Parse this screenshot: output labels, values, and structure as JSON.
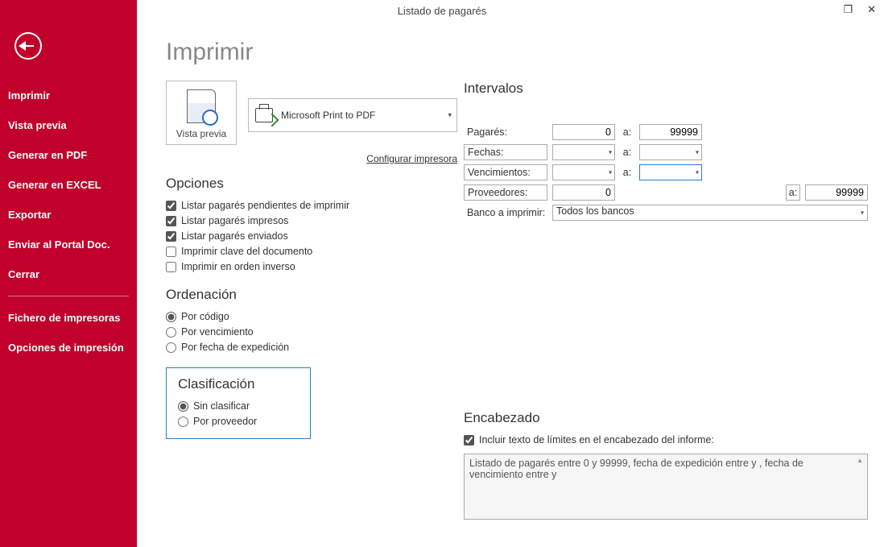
{
  "window": {
    "title": "Listado de pagarés"
  },
  "sidebar": {
    "items": [
      "Imprimir",
      "Vista previa",
      "Generar en PDF",
      "Generar en EXCEL",
      "Exportar",
      "Enviar al Portal Doc.",
      "Cerrar"
    ],
    "items2": [
      "Fichero de impresoras",
      "Opciones de impresión"
    ]
  },
  "page": {
    "title": "Imprimir",
    "preview_label": "Vista previa",
    "printer_name": "Microsoft Print to PDF",
    "config_link": "Configurar impresora"
  },
  "opciones": {
    "title": "Opciones",
    "items": [
      {
        "label": "Listar pagarés pendientes de imprimir",
        "checked": true
      },
      {
        "label": "Listar pagarés impresos",
        "checked": true
      },
      {
        "label": "Listar pagarés enviados",
        "checked": true
      },
      {
        "label": "Imprimir clave del documento",
        "checked": false
      },
      {
        "label": "Imprimir en orden inverso",
        "checked": false
      }
    ]
  },
  "ordenacion": {
    "title": "Ordenación",
    "items": [
      {
        "label": "Por código",
        "checked": true
      },
      {
        "label": "Por vencimiento",
        "checked": false
      },
      {
        "label": "Por fecha de expedición",
        "checked": false
      }
    ]
  },
  "clasificacion": {
    "title": "Clasificación",
    "items": [
      {
        "label": "Sin clasificar",
        "checked": true
      },
      {
        "label": "Por proveedor",
        "checked": false
      }
    ]
  },
  "intervalos": {
    "title": "Intervalos",
    "pagares_label": "Pagarés:",
    "pagares_from": "0",
    "pagares_to": "99999",
    "fechas_label": "Fechas:",
    "vencimientos_label": "Vencimientos:",
    "proveedores_label": "Proveedores:",
    "proveedores_from": "0",
    "proveedores_to": "99999",
    "a_label": "a:",
    "banco_label": "Banco a imprimir:",
    "banco_value": "Todos los bancos"
  },
  "encabezado": {
    "title": "Encabezado",
    "chk_label": "Incluir texto de límites en el encabezado del informe:",
    "chk_checked": true,
    "text": "Listado de pagarés entre 0 y 99999, fecha de expedición entre  y , fecha de vencimiento entre  y"
  }
}
